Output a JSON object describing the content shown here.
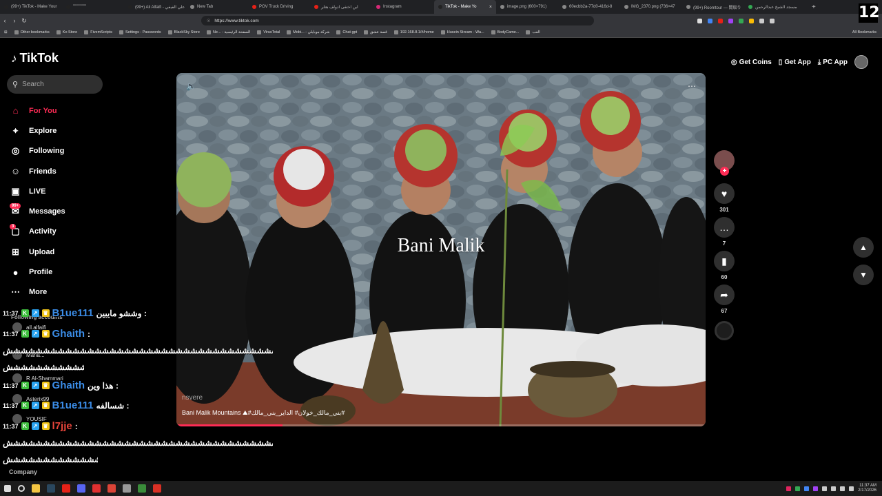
{
  "browser": {
    "tabs": [
      {
        "label": "(99+) TikTok - Make Your",
        "color": "#222",
        "active": false
      },
      {
        "label": "\"\"\"\"\"\"\"\"\"",
        "color": "#222",
        "active": false
      },
      {
        "label": "(99+) Ali Alfaifi - علي الفيفي",
        "color": "#222",
        "active": false
      },
      {
        "label": "New Tab",
        "color": "#888",
        "active": false
      },
      {
        "label": "POV Truck Driving",
        "color": "#e62117",
        "active": false
      },
      {
        "label": "ابن اختفى ادولف هتلر",
        "color": "#e62117",
        "active": false
      },
      {
        "label": "Instagram",
        "color": "#d62976",
        "active": false
      },
      {
        "label": "TikTok - Make Yo",
        "color": "#222",
        "active": true
      },
      {
        "label": "image.png (600×791)",
        "color": "#888",
        "active": false
      },
      {
        "label": "60ecbb2a-77d0-416d-8",
        "color": "#888",
        "active": false
      },
      {
        "label": "IMG_2370.png (736×47",
        "color": "#888",
        "active": false
      },
      {
        "label": "(99+) Roomtour — 間取り",
        "color": "#888",
        "active": false
      },
      {
        "label": "مسجد الشيخ عبدالرحمن",
        "color": "#34a853",
        "active": false
      }
    ],
    "url": "https://www.tiktok.com",
    "bookmarks": [
      "Other bookmarks",
      "Ko Store",
      "FivemScripts",
      "Settings - Passwords",
      "BlackSky Store",
      "Ne... - الصفحة الرئيسية",
      "VirusTotal",
      "Mobi... - شركة موبايلي",
      "Chat gpt",
      "قصة عشق",
      "192.168.8.1/#/home",
      "Husein Stream - Wa...",
      "BodyCame...",
      "العب"
    ],
    "bookmarks_right": "All Bookmarks",
    "overlay_badge": "12"
  },
  "tiktok": {
    "logo": "TikTok",
    "search_placeholder": "Search",
    "nav": [
      {
        "label": "For You",
        "icon": "home-icon",
        "glyph": "⌂",
        "active": true
      },
      {
        "label": "Explore",
        "icon": "compass-icon",
        "glyph": "⌖",
        "active": false
      },
      {
        "label": "Following",
        "icon": "following-icon",
        "glyph": "◎",
        "active": false
      },
      {
        "label": "Friends",
        "icon": "friends-icon",
        "glyph": "☺",
        "active": false
      },
      {
        "label": "LIVE",
        "icon": "live-icon",
        "glyph": "▣",
        "active": false
      },
      {
        "label": "Messages",
        "icon": "messages-icon",
        "glyph": "✉",
        "active": false,
        "badge": "99+"
      },
      {
        "label": "Activity",
        "icon": "activity-icon",
        "glyph": "▢",
        "active": false,
        "badge": "3"
      },
      {
        "label": "Upload",
        "icon": "upload-icon",
        "glyph": "⊞",
        "active": false
      },
      {
        "label": "Profile",
        "icon": "profile-icon",
        "glyph": "●",
        "active": false
      },
      {
        "label": "More",
        "icon": "more-icon",
        "glyph": "⋯",
        "active": false
      }
    ],
    "following_label": "Following accounts",
    "following_accounts": [
      {
        "name": "all.alfaifi",
        "sub": ""
      },
      {
        "name": "Maria...",
        "sub": ""
      },
      {
        "name": "R Al-Shammari",
        "sub": ""
      },
      {
        "name": "Asterix99",
        "sub": ""
      },
      {
        "name": "YOUSIF",
        "sub": ""
      }
    ],
    "company": "Company",
    "top_actions": [
      {
        "label": "Get Coins",
        "icon": "coin-icon",
        "glyph": "◎"
      },
      {
        "label": "Get App",
        "icon": "phone-icon",
        "glyph": "▯"
      },
      {
        "label": "PC App",
        "icon": "download-icon",
        "glyph": "⤓"
      }
    ],
    "video": {
      "overlay_title": "Bani Malik",
      "author": "nsvere",
      "caption": "Bani Malik Mountains ⛰#بني_مالك_خولان# الداير_بني_مالك#",
      "progress": 0.2
    },
    "side_actions": [
      {
        "name": "like",
        "icon": "heart-icon",
        "glyph": "♥",
        "count": "301"
      },
      {
        "name": "comment",
        "icon": "comment-icon",
        "glyph": "…",
        "count": "7"
      },
      {
        "name": "save",
        "icon": "bookmark-icon",
        "glyph": "▮",
        "count": "60"
      },
      {
        "name": "share",
        "icon": "share-icon",
        "glyph": "➦",
        "count": "67"
      }
    ]
  },
  "chat": {
    "lines": [
      {
        "time": "11:37",
        "user": "B1ue111",
        "msg": "وششو مايبين :",
        "red": false
      },
      {
        "time": "11:37",
        "user": "Ghaith",
        "msg": ":",
        "red": false
      },
      {
        "time": "11:37",
        "user": "Ghaith",
        "msg": "هذا وين :",
        "red": false
      },
      {
        "time": "11:37",
        "user": "B1ue111",
        "msg": "شسالفه :",
        "red": false
      },
      {
        "time": "11:37",
        "user": "l7jje",
        "msg": ":",
        "red": true
      }
    ],
    "spam1": "شششششششششششششششششششششششششششششششششششششششششش",
    "spam2": "ششششششششششششششش",
    "spam3": "شششششششششششششششششششششششششششششششششششششششششش",
    "spam4": "ششششششششششششششششش"
  },
  "taskbar": {
    "time": "11:37 AM",
    "date": "2/17/2026"
  },
  "colors": {
    "accent": "#fe2c55",
    "chat_user": "#3b8de8"
  }
}
